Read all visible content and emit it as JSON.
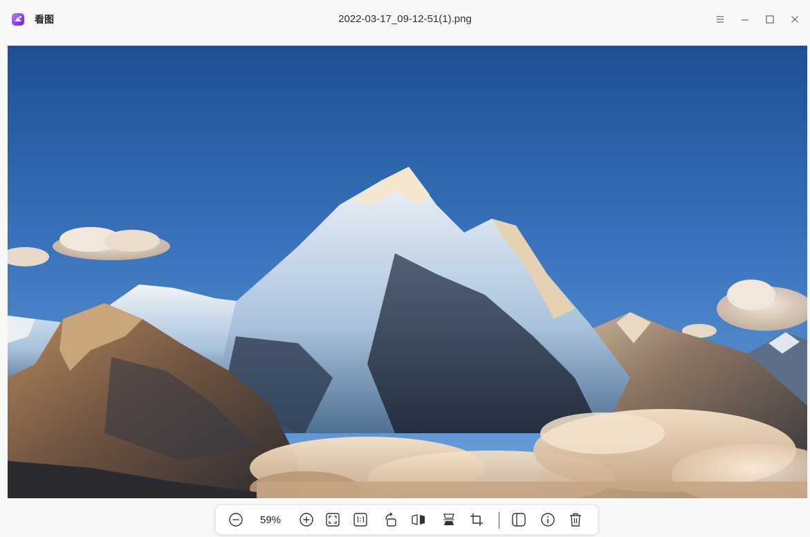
{
  "app": {
    "name": "看图",
    "icon": "viewer-app-logo-icon"
  },
  "window": {
    "title": "2022-03-17_09-12-51(1).png",
    "controls": [
      "menu-icon",
      "minimize-icon",
      "maximize-icon",
      "close-icon"
    ]
  },
  "image": {
    "description_icon": "mountain-landscape-image"
  },
  "toolbar": {
    "zoom_level": "59%",
    "buttons": [
      "zoom-out-icon",
      "zoom-in-icon",
      "fit-window-icon",
      "original-size-icon",
      "rotate-icon",
      "flip-horizontal-icon",
      "flip-vertical-icon",
      "crop-icon",
      "thumbnail-panel-icon",
      "info-icon",
      "delete-icon"
    ]
  },
  "colors": {
    "accent": "#8a3ffc",
    "titlebar_bg": "#f8f8f8",
    "sky_top": "#1e4f91",
    "sky_bottom": "#5b96d6"
  }
}
